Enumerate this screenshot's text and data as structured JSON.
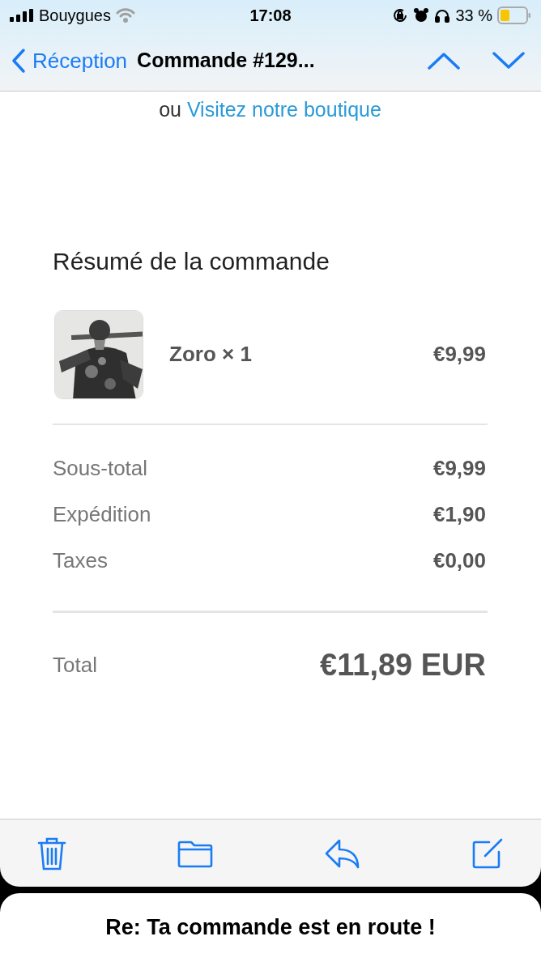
{
  "status_bar": {
    "carrier": "Bouygues",
    "time": "17:08",
    "battery": "33 %"
  },
  "nav": {
    "back": "Réception",
    "title": "Commande #129..."
  },
  "intro": {
    "prefix": "ou",
    "link": "Visitez notre boutique"
  },
  "summary": {
    "title": "Résumé de la commande",
    "items": [
      {
        "kind": "picture",
        "name": "Zoro × 1",
        "price": "€9,99"
      }
    ],
    "lines": [
      {
        "label": "Sous-total",
        "value": "€9,99"
      },
      {
        "label": "Expédition",
        "value": "€1,90"
      },
      {
        "label": "Taxes",
        "value": "€0,00"
      }
    ],
    "total": {
      "label": "Total",
      "value": "€11,89 EUR"
    }
  },
  "next_message": {
    "subject": "Re: Ta commande est en route !"
  }
}
